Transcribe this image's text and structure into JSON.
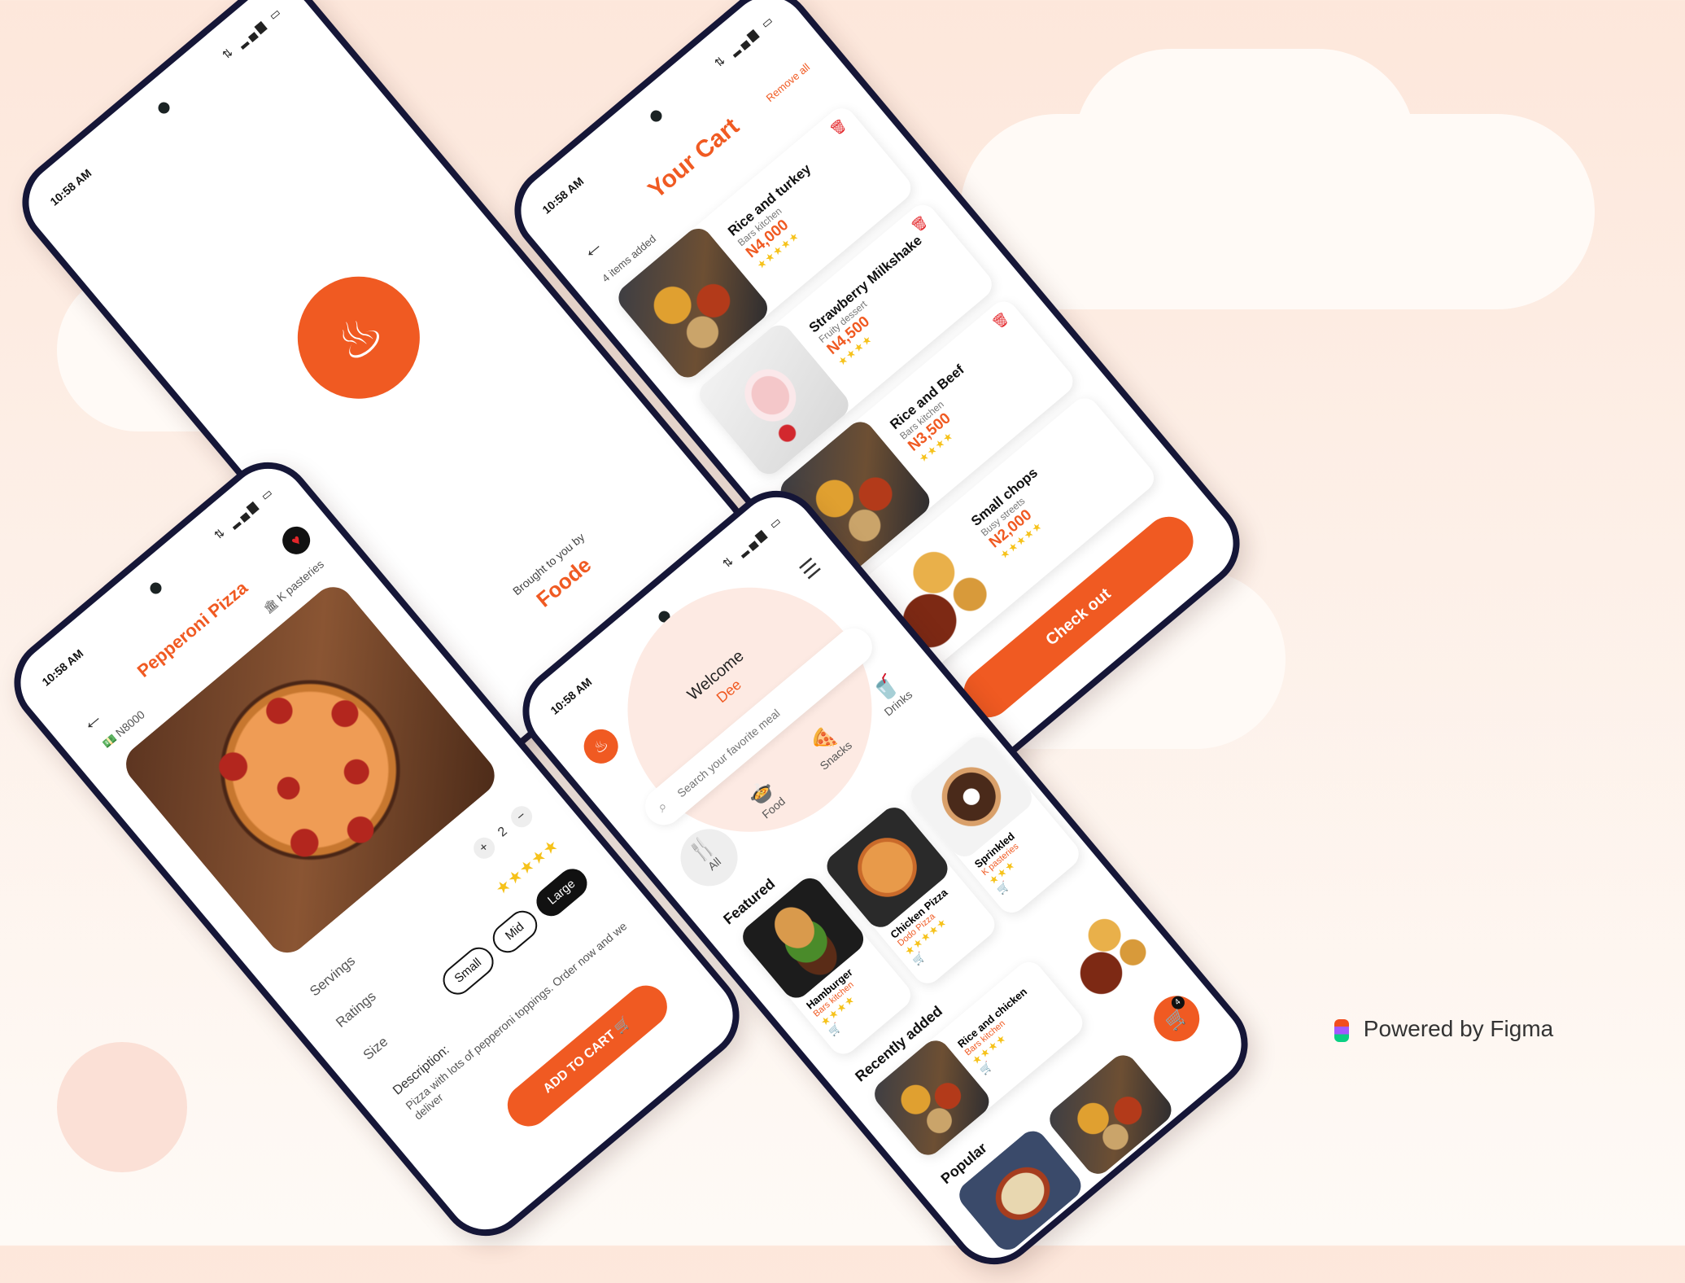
{
  "status": {
    "time": "10:58 AM",
    "signal": "1⇅ 4G ▏▐"
  },
  "splash": {
    "brought_by": "Brought to you by",
    "brand": "Foode"
  },
  "cart": {
    "title": "Your Cart",
    "remove_all": "Remove all",
    "items_added": "4 items added",
    "items": [
      {
        "name": "Rice and turkey",
        "vendor": "Bars kitchen",
        "price": "N4,000",
        "stars": "★★★★★"
      },
      {
        "name": "Strawberry Milkshake",
        "vendor": "Fruity dessert",
        "price": "N4,500",
        "stars": "★★★★"
      },
      {
        "name": "Rice and Beef",
        "vendor": "Bars kitchen",
        "price": "N3,500",
        "stars": "★★★★"
      },
      {
        "name": "Small chops",
        "vendor": "Busy streets",
        "price": "N2,000",
        "stars": "★★★★★"
      }
    ],
    "checkout": "Check out"
  },
  "product": {
    "title": "Pepperoni Pizza",
    "price": "N8000",
    "vendor": "K pasteries",
    "quantity": "2",
    "servings_label": "Servings",
    "ratings_label": "Ratings",
    "size_label": "Size",
    "sizes": [
      "Small",
      "Mid",
      "Large"
    ],
    "rating_stars": "★★★★★",
    "description_label": "Description:",
    "description": "Pizza with lots of pepperoni toppings. Order now and we deliver",
    "add_to_cart": "ADD TO CART"
  },
  "home": {
    "welcome": "Welcome",
    "user": "Dee",
    "search_placeholder": "Search your favorite meal",
    "categories": [
      "All",
      "Food",
      "Snacks",
      "Drinks"
    ],
    "featured_label": "Featured",
    "featured": [
      {
        "name": "Hamburger",
        "vendor": "Bars kitchen",
        "stars": "★★★★"
      },
      {
        "name": "Chicken Pizza",
        "vendor": "Dodo Pizza",
        "stars": "★★★★★"
      },
      {
        "name": "Sprinkled",
        "vendor": "K pasteries",
        "stars": "★★★"
      }
    ],
    "recent_label": "Recently added",
    "recent": [
      {
        "name": "Rice and chicken",
        "vendor": "Bars kitchen",
        "stars": "★★★★"
      }
    ],
    "popular_label": "Popular",
    "cart_count": "4"
  },
  "footer": {
    "powered": "Powered by Figma"
  },
  "colors": {
    "accent": "#f05a22",
    "frame": "#151637",
    "star": "#f6c21a"
  }
}
